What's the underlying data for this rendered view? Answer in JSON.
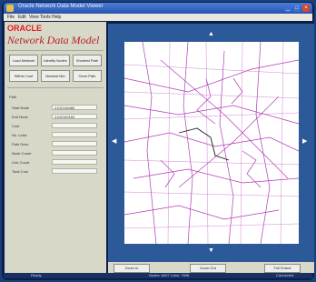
{
  "window": {
    "title": "Oracle Network Data Model Viewer"
  },
  "menu": [
    "File",
    "Edit",
    "View",
    "Tools",
    "Help"
  ],
  "brand": {
    "logo": "ORACLE",
    "app_title": "Network Data Model"
  },
  "toolbar": {
    "row1": [
      "Load Network",
      "Identify Nodes",
      "Shortest Path"
    ],
    "row2": [
      "Within Cost",
      "Nearest Nbr",
      "Clear Path"
    ]
  },
  "properties": {
    "section": "Path",
    "rows": [
      {
        "label": "Start Node",
        "value": "2102148480"
      },
      {
        "label": "End Node",
        "value": "2102150160"
      },
      {
        "label": "Cost",
        "value": ""
      },
      {
        "label": "No. Links",
        "value": ""
      },
      {
        "label": "Path Desc",
        "value": ""
      },
      {
        "label": "Node Count",
        "value": ""
      },
      {
        "label": "Link Count",
        "value": ""
      },
      {
        "label": "Total Cost",
        "value": ""
      }
    ]
  },
  "map": {
    "pan_up": "▲",
    "pan_down": "▼",
    "pan_left": "◀",
    "pan_right": "▶"
  },
  "actions": [
    "Zoom In",
    "Zoom Out",
    "Full Extent"
  ],
  "status": {
    "left": "Ready",
    "center": "Nodes: 6057  Links: 7698",
    "right": "Connected"
  }
}
